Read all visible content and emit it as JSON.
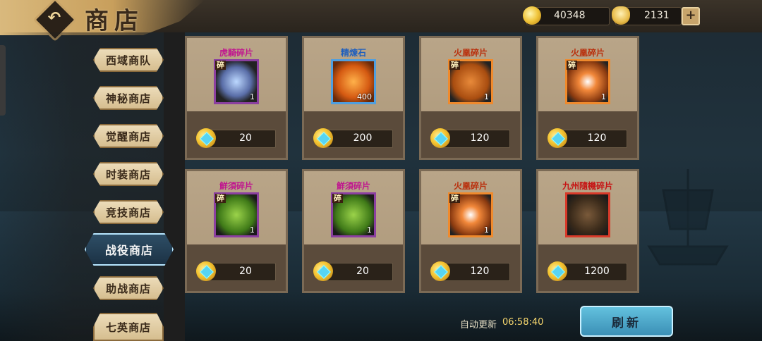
{
  "header": {
    "title": "商店",
    "currency_silver": "40348",
    "currency_gold": "2131",
    "plus_label": "+"
  },
  "sidebar": {
    "items": [
      {
        "label": "西域商队"
      },
      {
        "label": "神秘商店"
      },
      {
        "label": "觉醒商店"
      },
      {
        "label": "时装商店"
      },
      {
        "label": "竞技商店"
      },
      {
        "label": "战役商店",
        "active": true
      },
      {
        "label": "助战商店"
      },
      {
        "label": "七英商店"
      }
    ]
  },
  "shop": {
    "items": [
      {
        "name": "虎騎碎片",
        "qty": "1",
        "price": "20",
        "frame": "purple",
        "frag": "碎",
        "icon": "ring-icon"
      },
      {
        "name": "精煉石",
        "qty": "400",
        "price": "200",
        "frame": "blue",
        "frag": "",
        "icon": "refining-stone-icon"
      },
      {
        "name": "火凰碎片",
        "qty": "1",
        "price": "120",
        "frame": "orange",
        "frag": "碎",
        "icon": "ribbon-icon"
      },
      {
        "name": "火凰碎片",
        "qty": "1",
        "price": "120",
        "frame": "orange",
        "frag": "碎",
        "icon": "bracelet-icon"
      },
      {
        "name": "鮮須碎片",
        "qty": "1",
        "price": "20",
        "frame": "purple",
        "frag": "碎",
        "icon": "green-ribbon-icon"
      },
      {
        "name": "鮮須碎片",
        "qty": "1",
        "price": "20",
        "frame": "purple",
        "frag": "碎",
        "icon": "green-ribbon-icon"
      },
      {
        "name": "火凰碎片",
        "qty": "1",
        "price": "120",
        "frame": "orange",
        "frag": "碎",
        "icon": "bracelet-icon"
      },
      {
        "name": "九州隨機碎片",
        "qty": "",
        "price": "1200",
        "frame": "red",
        "frag": "",
        "icon": "random-fragment-icon"
      }
    ],
    "name_colors": {
      "purple": "#c0188f",
      "blue": "#1f5fbd",
      "orange": "#b92f0c",
      "red": "#c61414"
    }
  },
  "footer": {
    "refresh_label": "自动更新",
    "refresh_time": "06:58:40",
    "refresh_button": "刷新"
  }
}
